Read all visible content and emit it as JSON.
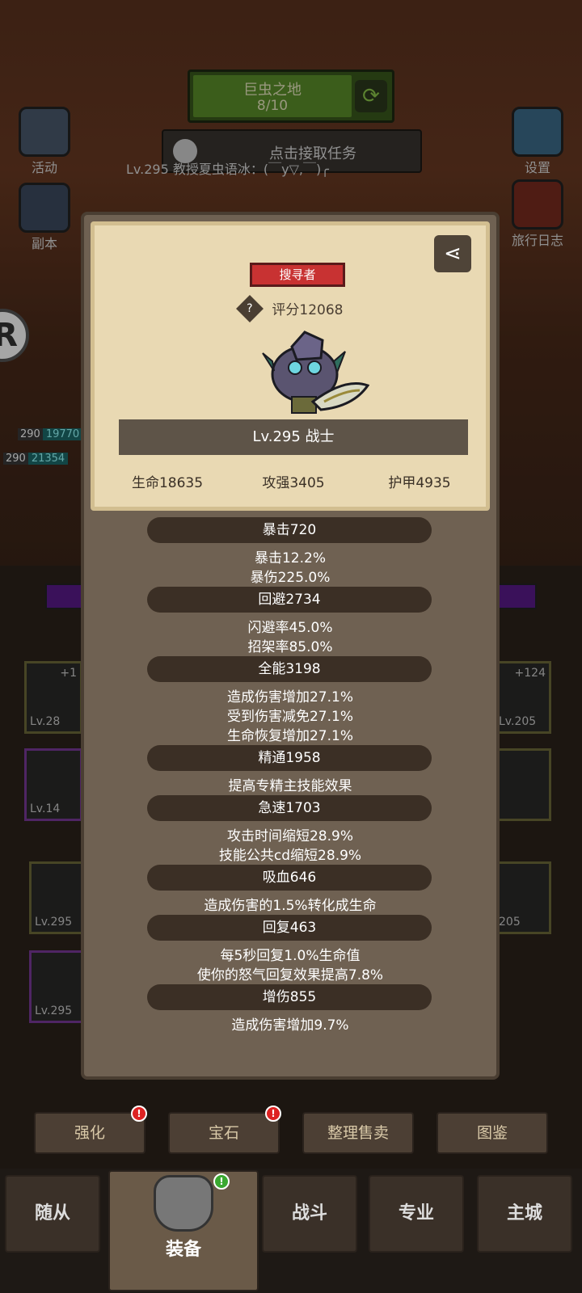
{
  "top_hud": {
    "zone_title": "巨虫之地",
    "zone_progress": "8/10",
    "task_label": "点击接取任务",
    "chat_line": "Lv.295 教授夏虫语冰：(￣y▽,￣)╭"
  },
  "side_buttons": {
    "activity": "活动",
    "dungeon": "副本",
    "settings": "设置",
    "travel_log": "旅行日志"
  },
  "float_icon_letter": "R",
  "party_hp": [
    {
      "lv": "290",
      "value": "19770"
    },
    {
      "lv": "290",
      "value": "21354"
    }
  ],
  "equipment_slots": [
    {
      "plus": "+1",
      "lv": "Lv.28"
    },
    {
      "plus": "+124",
      "lv": "Lv.205"
    },
    {
      "plus": "",
      "lv": "Lv.14"
    },
    {
      "plus": "",
      "lv": "Lv.295"
    },
    {
      "plus": "",
      "lv": "205"
    },
    {
      "plus": "",
      "lv": "Lv.295"
    }
  ],
  "profile": {
    "role_badge": "搜寻者",
    "score": "评分12068",
    "level_class": "Lv.295 战士",
    "hp": "生命18635",
    "attack": "攻强3405",
    "armor": "护甲4935"
  },
  "attributes": [
    {
      "header": "暴击720",
      "lines": [
        "暴击12.2%",
        "暴伤225.0%"
      ]
    },
    {
      "header": "回避2734",
      "lines": [
        "闪避率45.0%",
        "招架率85.0%"
      ]
    },
    {
      "header": "全能3198",
      "lines": [
        "造成伤害增加27.1%",
        "受到伤害减免27.1%",
        "生命恢复增加27.1%"
      ]
    },
    {
      "header": "精通1958",
      "lines": [
        "提高专精主技能效果"
      ]
    },
    {
      "header": "急速1703",
      "lines": [
        "攻击时间缩短28.9%",
        "技能公共cd缩短28.9%"
      ]
    },
    {
      "header": "吸血646",
      "lines": [
        "造成伤害的1.5%转化成生命"
      ]
    },
    {
      "header": "回复463",
      "lines": [
        "每5秒回复1.0%生命值",
        "使你的怒气回复效果提高7.8%"
      ]
    },
    {
      "header": "增伤855",
      "lines": [
        "造成伤害增加9.7%"
      ]
    }
  ],
  "actions": {
    "enhance": "强化",
    "gem": "宝石",
    "sort_sell": "整理售卖",
    "codex": "图鉴"
  },
  "nav": {
    "follower": "随从",
    "equipment": "装备",
    "battle": "战斗",
    "profession": "专业",
    "main_city": "主城"
  },
  "colors": {
    "badge_red": "#c83232",
    "panel_parchment": "#e9d9b3",
    "panel_brown": "#6f6152"
  }
}
